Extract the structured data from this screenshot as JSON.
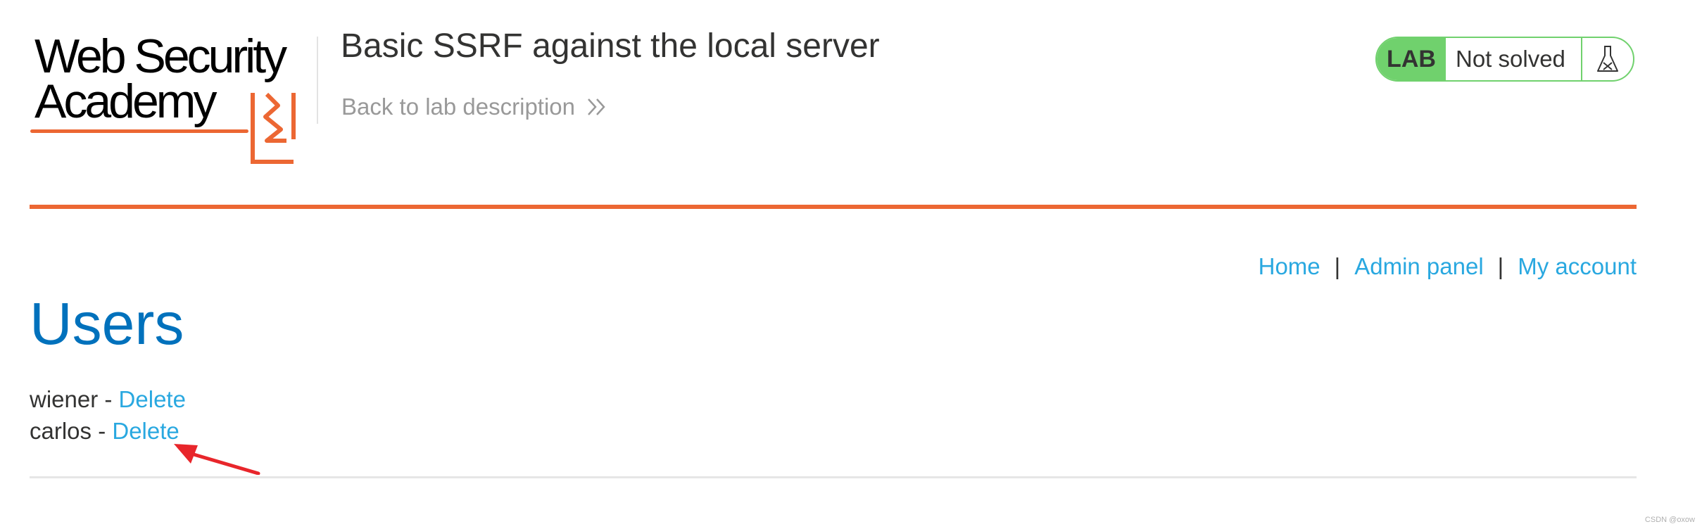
{
  "header": {
    "logo": {
      "line1": "Web Security",
      "line2": "Academy"
    },
    "lab_title": "Basic SSRF against the local server",
    "back_link": "Back to lab description",
    "lab_status": {
      "badge": "LAB",
      "state": "Not solved",
      "icon": "flask-icon"
    }
  },
  "nav": {
    "items": [
      "Home",
      "Admin panel",
      "My account"
    ],
    "separator": "|"
  },
  "main": {
    "heading": "Users",
    "users": [
      {
        "name": "wiener",
        "sep": " - ",
        "action": "Delete"
      },
      {
        "name": "carlos",
        "sep": " - ",
        "action": "Delete"
      }
    ]
  },
  "watermark": "CSDN @oxow",
  "colors": {
    "brand_orange": "#ec6733",
    "lab_green": "#70d16d",
    "link_blue": "#29a8e0",
    "heading_blue": "#0071bc",
    "annotation_red": "#e8262b"
  }
}
